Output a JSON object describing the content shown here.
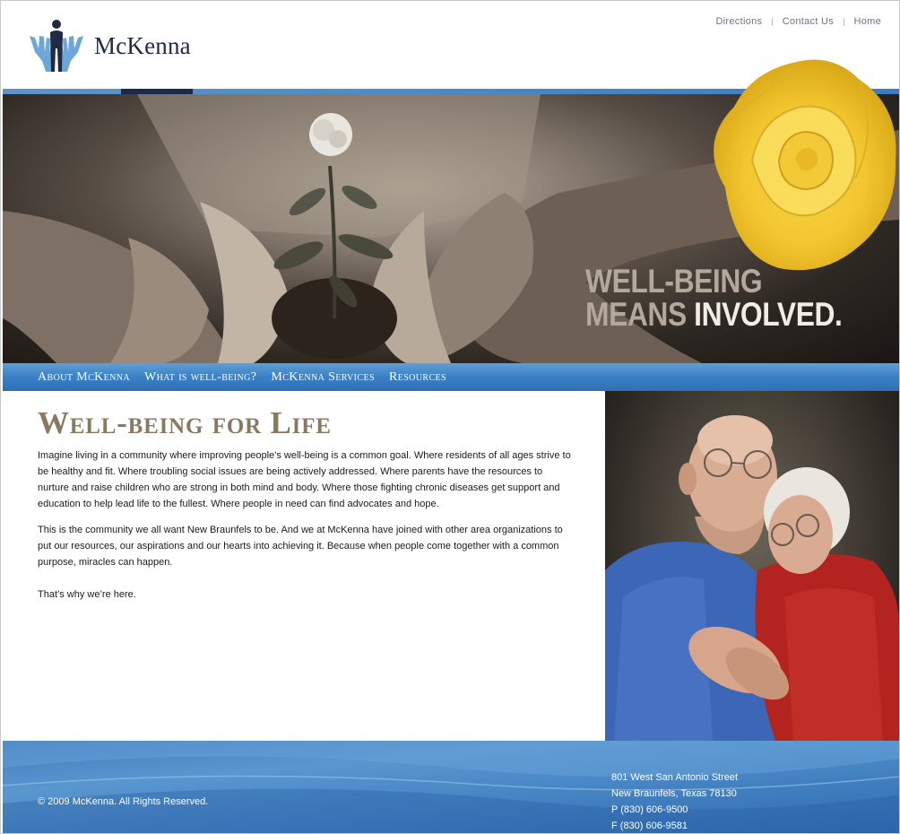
{
  "brand": {
    "name": "McKenna",
    "logo_icon": "hands-people-icon"
  },
  "utility_nav": {
    "items": [
      "Directions",
      "Contact Us",
      "Home"
    ],
    "separator": "|"
  },
  "hero": {
    "tagline_line1": "WELL-BEING",
    "tagline_line2a": "MEANS",
    "tagline_line2b": "INVOLVED."
  },
  "main_nav": {
    "items": [
      "About McKenna",
      "What is well-being?",
      "McKenna Services",
      "Resources"
    ]
  },
  "content": {
    "title": "Well-being for Life",
    "paragraphs": [
      "Imagine living in a community where improving people’s well-being is a common goal. Where residents of all ages strive to be healthy and fit. Where troubling social issues are being actively addressed. Where parents have the resources to nurture and raise children who are strong in both mind and body. Where those fighting chronic diseases get support and education to help lead life to the fullest. Where people in need can find advocates and hope.",
      "This is the community we all want New Braunfels to be.  And we at McKenna have joined with other area organizations to put our resources, our aspirations and our hearts into achieving it.  Because when people come together with a common purpose, miracles can happen.",
      "That’s why we’re here."
    ]
  },
  "footer": {
    "copyright": "© 2009 McKenna. All Rights Reserved.",
    "address_line1": "801 West San Antonio Street",
    "address_line2": "New Braunfels, Texas 78130",
    "phone": "P (830) 606-9500",
    "fax": "F (830) 606-9581"
  },
  "colors": {
    "nav_blue": "#3a80c6",
    "title_brown": "#8a7961",
    "logo_navy": "#1f2a44",
    "logo_light_blue": "#6ea6d8",
    "rose_yellow": "#f6cf3a"
  }
}
